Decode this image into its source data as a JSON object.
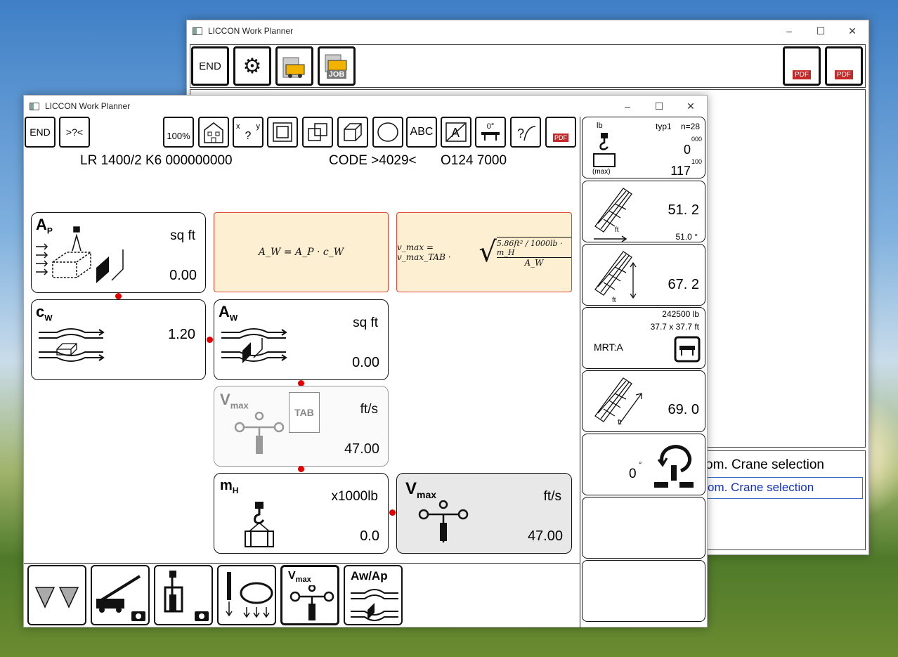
{
  "back_window": {
    "title": "LICCON Work Planner",
    "toolbar": {
      "end": "END",
      "job": "JOB",
      "pdf1": "PDF",
      "pdf2": "PDF"
    },
    "list_heading": "om. Crane selection",
    "list_selected": "om. Crane selection"
  },
  "front_window": {
    "title": "LICCON Work Planner",
    "toolbar": {
      "end": "END",
      "query": ">?<",
      "zoom": "100%",
      "text": "ABC",
      "angle": "0°",
      "pdf": "PDF",
      "xy_x": "x",
      "xy_y": "y",
      "xy_q": "?"
    },
    "header": {
      "model": "LR 1400/2 K6  000000000",
      "code": "CODE >4029<",
      "number": "O124 7000"
    },
    "cards": {
      "ap": {
        "label": "A",
        "sub": "P",
        "unit": "sq ft",
        "value": "0.00"
      },
      "cw": {
        "label": "c",
        "sub": "W",
        "value": "1.20"
      },
      "aw": {
        "label": "A",
        "sub": "W",
        "unit": "sq ft",
        "value": "0.00"
      },
      "vmax_tab": {
        "label": "V",
        "sub": "max",
        "tab": "TAB",
        "unit": "ft/s",
        "value": "47.00"
      },
      "mh": {
        "label": "m",
        "sub": "H",
        "unit": "x1000lb",
        "value": "0.0"
      },
      "vmax": {
        "label": "V",
        "sub": "max",
        "unit": "ft/s",
        "value": "47.00"
      }
    },
    "formulas": {
      "aw": "A_W = A_P · c_W",
      "vmax_lhs": "v_max = v_max_TAB ·",
      "vmax_num": "5.86ft² / 1000lb · m_H",
      "vmax_den": "A_W"
    },
    "right_panel": {
      "load": {
        "unit": "lb",
        "type": "typ1",
        "n": "n=28",
        "value": "0",
        "sup": "000",
        "max_label": "(max)",
        "max": "117",
        "max_sup": "100"
      },
      "boom_angle": {
        "value": "51. 2",
        "angle": "51.0 °",
        "unit": "ft"
      },
      "boom_length": {
        "value": "67. 2",
        "unit": "ft"
      },
      "counterweight": {
        "weight": "242500 lb",
        "size": "37.7 x 37.7 ft",
        "label": "MRT:A"
      },
      "radius": {
        "value": "69. 0",
        "unit": "ft"
      },
      "slew": {
        "value": "0",
        "deg": "°"
      }
    },
    "bottom": {
      "vmax": "V",
      "vmax_sub": "max",
      "awap": "Aw/Ap"
    }
  }
}
